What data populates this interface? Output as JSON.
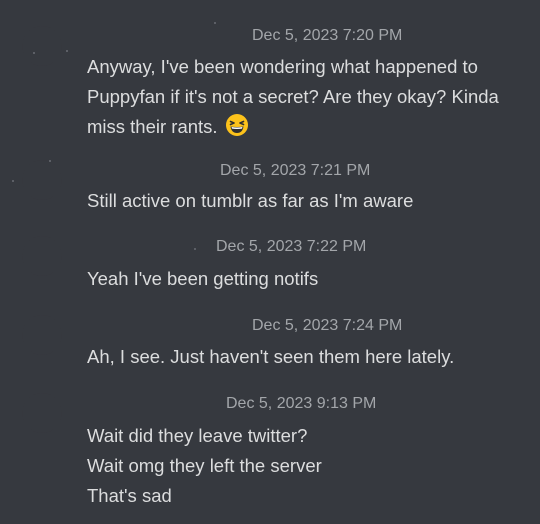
{
  "messages": [
    {
      "timestamp": "Dec 5, 2023 7:20 PM",
      "lines": [
        "Anyway, I've been wondering what happened to",
        "Puppyfan if it's not a secret? Are they okay? Kinda",
        "miss their rants."
      ],
      "emoji": "grinning-squinting-face"
    },
    {
      "timestamp": "Dec 5, 2023 7:21 PM",
      "lines": [
        "Still active on tumblr as far as I'm aware"
      ]
    },
    {
      "timestamp": "Dec 5, 2023 7:22 PM",
      "lines": [
        "Yeah I've been getting notifs"
      ]
    },
    {
      "timestamp": "Dec 5, 2023 7:24 PM",
      "lines": [
        "Ah, I see. Just haven't seen them here lately."
      ]
    },
    {
      "timestamp": "Dec 5, 2023 9:13 PM",
      "lines": [
        "Wait did they leave twitter?",
        "Wait omg they left the server",
        "That's sad"
      ]
    }
  ]
}
